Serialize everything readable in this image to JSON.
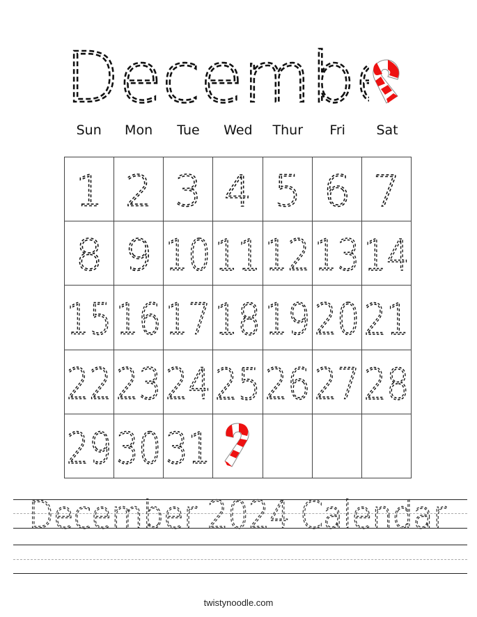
{
  "worksheet": {
    "title": "December",
    "title_icon": "candy-cane-icon",
    "weekdays": [
      "Sun",
      "Mon",
      "Tue",
      "Wed",
      "Thur",
      "Fri",
      "Sat"
    ],
    "weeks": [
      [
        "1",
        "2",
        "3",
        "4",
        "5",
        "6",
        "7"
      ],
      [
        "8",
        "9",
        "10",
        "11",
        "12",
        "13",
        "14"
      ],
      [
        "15",
        "16",
        "17",
        "18",
        "19",
        "20",
        "21"
      ],
      [
        "22",
        "23",
        "24",
        "25",
        "26",
        "27",
        "28"
      ],
      [
        "29",
        "30",
        "31",
        "",
        "",
        "",
        ""
      ]
    ],
    "last_row_icon": "candy-cane-icon",
    "trace_text": "December 2024 Calendar",
    "footer": "twistynoodle.com",
    "colors": {
      "cane_red": "#ee1111",
      "ink": "#111111",
      "guide": "#aaaaaa"
    }
  }
}
